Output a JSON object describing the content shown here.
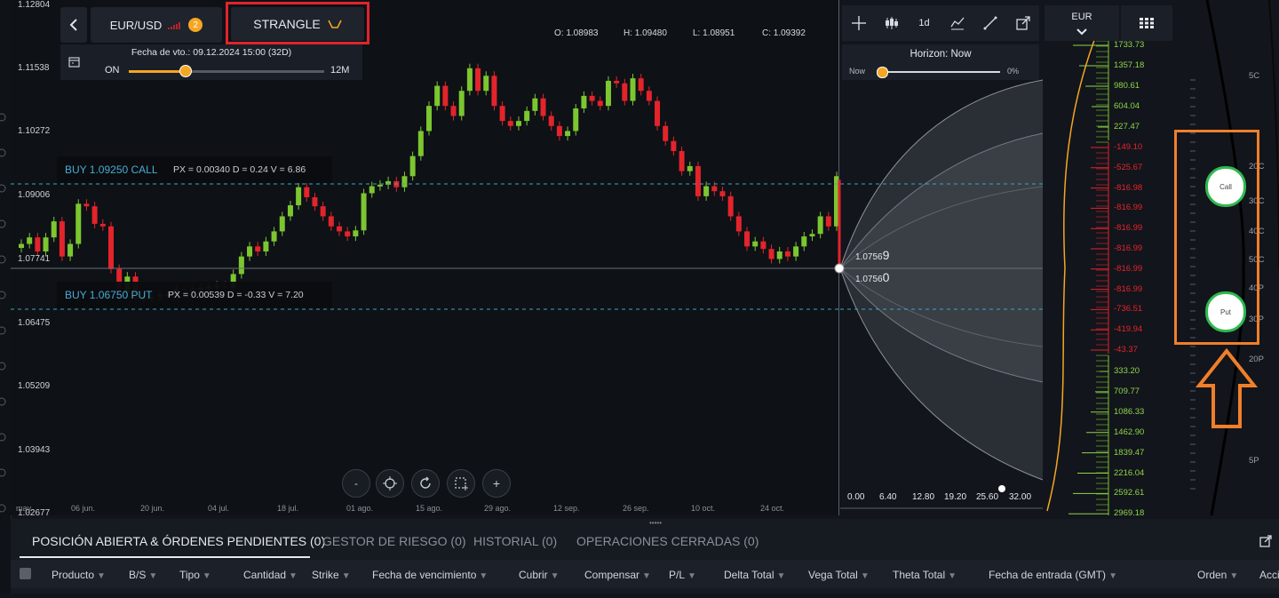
{
  "toolbar": {
    "pair": "EUR/USD",
    "pair_badge": "2",
    "strategy": "STRANGLE",
    "expiry": "Fecha de vto.: 09.12.2024 15:00 (32D)",
    "slider_left": "ON",
    "slider_right": "12M",
    "ohlc": {
      "o": "O: 1.08983",
      "h": "H: 1.09480",
      "l": "L: 1.08951",
      "c": "C: 1.09392"
    },
    "tool_1d": "1d",
    "currency": "EUR"
  },
  "horizon": {
    "title": "Horizon: Now",
    "left": "Now",
    "right": "0%"
  },
  "y_axis": [
    "1.12804",
    "1.11538",
    "1.10272",
    "1.09006",
    "1.07741",
    "1.06475",
    "1.05209",
    "1.03943",
    "1.02677"
  ],
  "x_axis": [
    "may.",
    "06 jun.",
    "20 jun.",
    "04 jul.",
    "18 jul.",
    "01 ago.",
    "15 ago.",
    "29 ago.",
    "12 sep.",
    "26 sep.",
    "10 oct.",
    "24 oct."
  ],
  "orders": {
    "call": {
      "label": "BUY 1.09250 CALL",
      "info": "PX = 0.00340 D = 0.24 V = 6.86"
    },
    "put": {
      "label": "BUY 1.06750 PUT",
      "info": "PX = 0.00539 D = -0.33 V = 7.20"
    }
  },
  "price_labels": {
    "top_main": "1.0756",
    "top_sup": "9",
    "bottom_main": "1.0756",
    "bottom_sup": "0"
  },
  "dist_axis": [
    "0.00",
    "6.40",
    "12.80",
    "19.20",
    "25.60",
    "32.00"
  ],
  "vol_values_green_top": [
    "1733.73",
    "1357.18",
    "980.61",
    "604.04",
    "227.47"
  ],
  "vol_values_red": [
    "-149.10",
    "-525.67",
    "-816.98",
    "-816.99",
    "-816.99",
    "-816.99",
    "-816.99",
    "-816.99",
    "-736.51",
    "-419.94",
    "-43.37"
  ],
  "vol_values_green_bottom": [
    "333.20",
    "709.77",
    "1086.33",
    "1462.90",
    "1839.47",
    "2216.04",
    "2592.61",
    "2969.18"
  ],
  "strike_labels": [
    "5C",
    "20C",
    "30C",
    "40C",
    "50C",
    "40P",
    "30P",
    "20P",
    "5P"
  ],
  "strike_circles": {
    "call": "Call",
    "put": "Put"
  },
  "chart_data": {
    "type": "candlestick",
    "title": "EUR/USD",
    "y_ticks": [
      1.12804,
      1.11538,
      1.10272,
      1.09006,
      1.07741,
      1.06475,
      1.05209,
      1.03943,
      1.02677
    ],
    "ylim": [
      1.02677,
      1.12804
    ],
    "close": [
      1.0805,
      1.0818,
      1.079,
      1.0818,
      1.085,
      1.078,
      1.0805,
      1.0885,
      1.088,
      1.0845,
      1.084,
      1.0755,
      1.0708,
      1.074,
      1.0698,
      1.0698,
      1.07,
      1.0705,
      1.0705,
      1.0715,
      1.0712,
      1.0715,
      1.0718,
      1.072,
      1.0722,
      1.0718,
      1.0745,
      1.078,
      1.08,
      1.079,
      1.081,
      1.083,
      1.086,
      1.0882,
      1.0918,
      1.0898,
      1.088,
      1.086,
      1.084,
      1.083,
      1.082,
      1.0832,
      1.0906,
      1.092,
      1.0923,
      1.093,
      1.0918,
      1.094,
      1.098,
      1.103,
      1.108,
      1.112,
      1.108,
      1.106,
      1.111,
      1.1155,
      1.111,
      1.114,
      1.108,
      1.105,
      1.104,
      1.105,
      1.107,
      1.1095,
      1.106,
      1.104,
      1.102,
      1.103,
      1.1075,
      1.11,
      1.109,
      1.108,
      1.113,
      1.1125,
      1.109,
      1.1135,
      1.111,
      1.109,
      1.104,
      1.101,
      1.099,
      1.095,
      1.096,
      1.09,
      1.092,
      1.091,
      1.09,
      1.086,
      1.083,
      1.08,
      1.081,
      1.0795,
      1.0775,
      1.079,
      1.078,
      1.08,
      1.082,
      1.0825,
      1.086,
      1.084,
      1.094
    ]
  },
  "bottom": {
    "tabs": [
      "POSICIÓN ABIERTA & ÓRDENES PENDIENTES (0)",
      "GESTOR DE RIESGO (0)",
      "HISTORIAL (0)",
      "OPERACIONES CERRADAS (0)"
    ],
    "columns": [
      "Producto",
      "B/S",
      "Tipo",
      "Cantidad",
      "Strike",
      "Fecha de vencimiento",
      "Cubrir",
      "Compensar",
      "P/L",
      "Delta Total",
      "Vega Total",
      "Theta Total",
      "Fecha de entrada (GMT)",
      "Orden",
      "Acci"
    ]
  },
  "highlight_colors": {
    "red_box": "#e0242b",
    "orange_box": "#f07f2a",
    "bull": "#7cc630",
    "bear": "#e3242b",
    "accent": "#f5a623"
  }
}
